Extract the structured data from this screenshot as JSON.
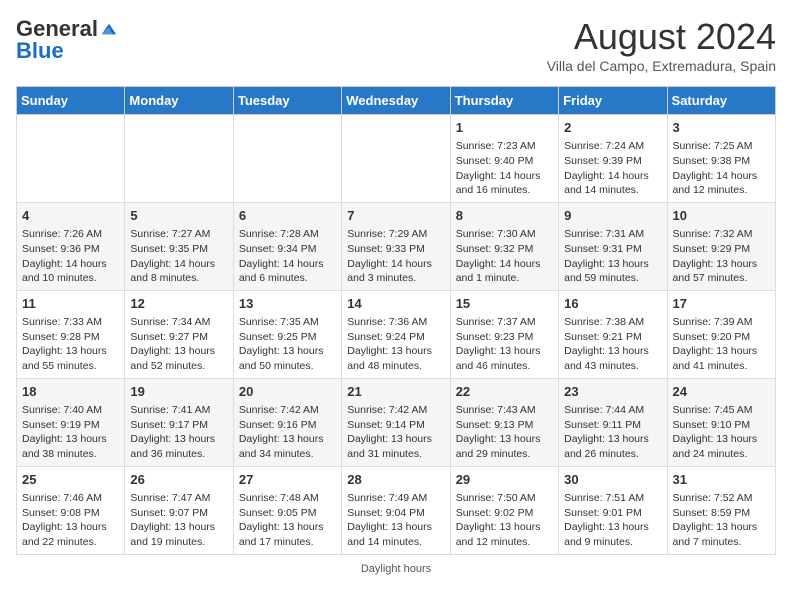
{
  "header": {
    "logo_general": "General",
    "logo_blue": "Blue",
    "main_title": "August 2024",
    "subtitle": "Villa del Campo, Extremadura, Spain"
  },
  "calendar": {
    "weekdays": [
      "Sunday",
      "Monday",
      "Tuesday",
      "Wednesday",
      "Thursday",
      "Friday",
      "Saturday"
    ],
    "weeks": [
      [
        {
          "day": "",
          "info": ""
        },
        {
          "day": "",
          "info": ""
        },
        {
          "day": "",
          "info": ""
        },
        {
          "day": "",
          "info": ""
        },
        {
          "day": "1",
          "info": "Sunrise: 7:23 AM\nSunset: 9:40 PM\nDaylight: 14 hours and 16 minutes."
        },
        {
          "day": "2",
          "info": "Sunrise: 7:24 AM\nSunset: 9:39 PM\nDaylight: 14 hours and 14 minutes."
        },
        {
          "day": "3",
          "info": "Sunrise: 7:25 AM\nSunset: 9:38 PM\nDaylight: 14 hours and 12 minutes."
        }
      ],
      [
        {
          "day": "4",
          "info": "Sunrise: 7:26 AM\nSunset: 9:36 PM\nDaylight: 14 hours and 10 minutes."
        },
        {
          "day": "5",
          "info": "Sunrise: 7:27 AM\nSunset: 9:35 PM\nDaylight: 14 hours and 8 minutes."
        },
        {
          "day": "6",
          "info": "Sunrise: 7:28 AM\nSunset: 9:34 PM\nDaylight: 14 hours and 6 minutes."
        },
        {
          "day": "7",
          "info": "Sunrise: 7:29 AM\nSunset: 9:33 PM\nDaylight: 14 hours and 3 minutes."
        },
        {
          "day": "8",
          "info": "Sunrise: 7:30 AM\nSunset: 9:32 PM\nDaylight: 14 hours and 1 minute."
        },
        {
          "day": "9",
          "info": "Sunrise: 7:31 AM\nSunset: 9:31 PM\nDaylight: 13 hours and 59 minutes."
        },
        {
          "day": "10",
          "info": "Sunrise: 7:32 AM\nSunset: 9:29 PM\nDaylight: 13 hours and 57 minutes."
        }
      ],
      [
        {
          "day": "11",
          "info": "Sunrise: 7:33 AM\nSunset: 9:28 PM\nDaylight: 13 hours and 55 minutes."
        },
        {
          "day": "12",
          "info": "Sunrise: 7:34 AM\nSunset: 9:27 PM\nDaylight: 13 hours and 52 minutes."
        },
        {
          "day": "13",
          "info": "Sunrise: 7:35 AM\nSunset: 9:25 PM\nDaylight: 13 hours and 50 minutes."
        },
        {
          "day": "14",
          "info": "Sunrise: 7:36 AM\nSunset: 9:24 PM\nDaylight: 13 hours and 48 minutes."
        },
        {
          "day": "15",
          "info": "Sunrise: 7:37 AM\nSunset: 9:23 PM\nDaylight: 13 hours and 46 minutes."
        },
        {
          "day": "16",
          "info": "Sunrise: 7:38 AM\nSunset: 9:21 PM\nDaylight: 13 hours and 43 minutes."
        },
        {
          "day": "17",
          "info": "Sunrise: 7:39 AM\nSunset: 9:20 PM\nDaylight: 13 hours and 41 minutes."
        }
      ],
      [
        {
          "day": "18",
          "info": "Sunrise: 7:40 AM\nSunset: 9:19 PM\nDaylight: 13 hours and 38 minutes."
        },
        {
          "day": "19",
          "info": "Sunrise: 7:41 AM\nSunset: 9:17 PM\nDaylight: 13 hours and 36 minutes."
        },
        {
          "day": "20",
          "info": "Sunrise: 7:42 AM\nSunset: 9:16 PM\nDaylight: 13 hours and 34 minutes."
        },
        {
          "day": "21",
          "info": "Sunrise: 7:42 AM\nSunset: 9:14 PM\nDaylight: 13 hours and 31 minutes."
        },
        {
          "day": "22",
          "info": "Sunrise: 7:43 AM\nSunset: 9:13 PM\nDaylight: 13 hours and 29 minutes."
        },
        {
          "day": "23",
          "info": "Sunrise: 7:44 AM\nSunset: 9:11 PM\nDaylight: 13 hours and 26 minutes."
        },
        {
          "day": "24",
          "info": "Sunrise: 7:45 AM\nSunset: 9:10 PM\nDaylight: 13 hours and 24 minutes."
        }
      ],
      [
        {
          "day": "25",
          "info": "Sunrise: 7:46 AM\nSunset: 9:08 PM\nDaylight: 13 hours and 22 minutes."
        },
        {
          "day": "26",
          "info": "Sunrise: 7:47 AM\nSunset: 9:07 PM\nDaylight: 13 hours and 19 minutes."
        },
        {
          "day": "27",
          "info": "Sunrise: 7:48 AM\nSunset: 9:05 PM\nDaylight: 13 hours and 17 minutes."
        },
        {
          "day": "28",
          "info": "Sunrise: 7:49 AM\nSunset: 9:04 PM\nDaylight: 13 hours and 14 minutes."
        },
        {
          "day": "29",
          "info": "Sunrise: 7:50 AM\nSunset: 9:02 PM\nDaylight: 13 hours and 12 minutes."
        },
        {
          "day": "30",
          "info": "Sunrise: 7:51 AM\nSunset: 9:01 PM\nDaylight: 13 hours and 9 minutes."
        },
        {
          "day": "31",
          "info": "Sunrise: 7:52 AM\nSunset: 8:59 PM\nDaylight: 13 hours and 7 minutes."
        }
      ]
    ]
  },
  "footer": {
    "note": "Daylight hours"
  }
}
